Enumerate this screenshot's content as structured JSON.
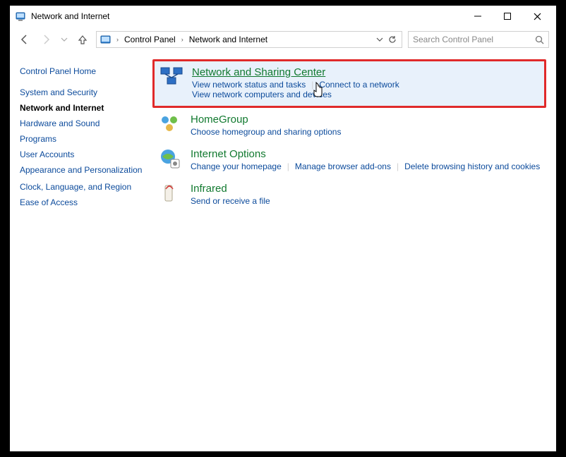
{
  "window": {
    "title": "Network and Internet"
  },
  "breadcrumb": {
    "root": "Control Panel",
    "current": "Network and Internet"
  },
  "search": {
    "placeholder": "Search Control Panel"
  },
  "sidebar": {
    "home": "Control Panel Home",
    "items": [
      "System and Security",
      "Network and Internet",
      "Hardware and Sound",
      "Programs",
      "User Accounts",
      "Appearance and Personalization",
      "Clock, Language, and Region",
      "Ease of Access"
    ],
    "active_index": 1
  },
  "categories": [
    {
      "title": "Network and Sharing Center",
      "links": [
        "View network status and tasks",
        "Connect to a network",
        "View network computers and devices"
      ],
      "highlight": true
    },
    {
      "title": "HomeGroup",
      "links": [
        "Choose homegroup and sharing options"
      ]
    },
    {
      "title": "Internet Options",
      "links": [
        "Change your homepage",
        "Manage browser add-ons",
        "Delete browsing history and cookies"
      ]
    },
    {
      "title": "Infrared",
      "links": [
        "Send or receive a file"
      ]
    }
  ]
}
